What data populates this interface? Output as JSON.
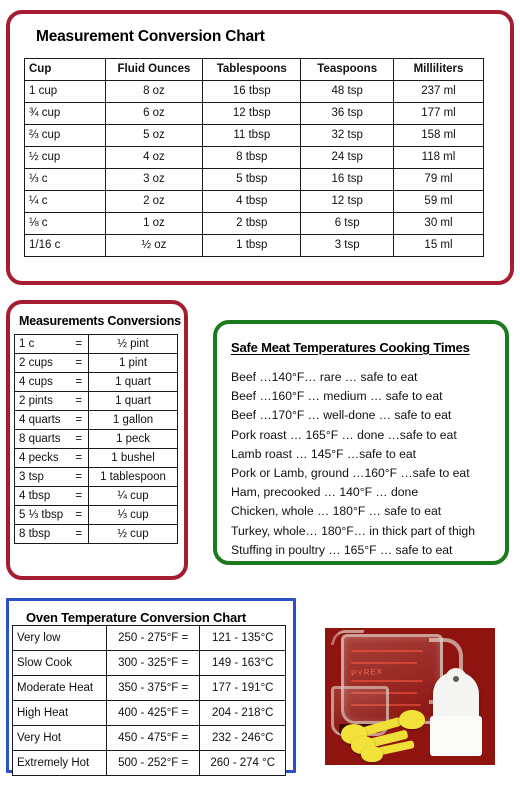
{
  "colors": {
    "red_border": "#a61c30",
    "green_border": "#1a7a1e",
    "blue_border": "#2b4fc4",
    "photo_background": "#8f1410"
  },
  "main_chart": {
    "title": "Measurement Conversion Chart",
    "headers": [
      "Cup",
      "Fluid Ounces",
      "Tablespoons",
      "Teaspoons",
      "Milliliters"
    ],
    "rows": [
      [
        "1 cup",
        "8 oz",
        "16 tbsp",
        "48 tsp",
        "237 ml"
      ],
      [
        "¾ cup",
        "6 oz",
        "12 tbsp",
        "36 tsp",
        "177 ml"
      ],
      [
        "⅔  cup",
        "5 oz",
        "11 tbsp",
        "32 tsp",
        "158 ml"
      ],
      [
        "½ cup",
        "4 oz",
        "8 tbsp",
        "24 tsp",
        "118 ml"
      ],
      [
        "⅓ c",
        "3 oz",
        "5 tbsp",
        "16 tsp",
        "79 ml"
      ],
      [
        "¼ c",
        "2 oz",
        "4 tbsp",
        "12 tsp",
        "59 ml"
      ],
      [
        "⅛ c",
        "1 oz",
        "2 tbsp",
        "6 tsp",
        "30 ml"
      ],
      [
        "1/16 c",
        "½ oz",
        "1 tbsp",
        "3 tsp",
        "15 ml"
      ]
    ]
  },
  "measurements": {
    "title": "Measurements Conversions",
    "equals_sign": "=",
    "rows": [
      {
        "quantity": "1 c",
        "result": "½ pint"
      },
      {
        "quantity": "2 cups",
        "result": "1 pint"
      },
      {
        "quantity": "4 cups",
        "result": "1 quart"
      },
      {
        "quantity": "2 pints",
        "result": "1 quart"
      },
      {
        "quantity": "4 quarts",
        "result": "1 gallon"
      },
      {
        "quantity": "8 quarts",
        "result": "1 peck"
      },
      {
        "quantity": "4 pecks",
        "result": "1 bushel"
      },
      {
        "quantity": "3 tsp",
        "result": "1 tablespoon"
      },
      {
        "quantity": "4 tbsp",
        "result": "¼ cup"
      },
      {
        "quantity": "5 ⅓ tbsp",
        "result": "⅓ cup"
      },
      {
        "quantity": "8 tbsp",
        "result": "½ cup"
      }
    ]
  },
  "meat": {
    "title": "Safe Meat Temperatures Cooking Times",
    "lines": [
      "Beef …140°F… rare … safe to eat",
      "Beef …160°F … medium … safe to eat",
      "Beef …170°F … well-done … safe to eat",
      "Pork roast … 165°F …  done …safe to eat",
      "Lamb roast … 145°F …safe to eat",
      "Pork or Lamb, ground …160°F …safe to eat",
      "Ham, precooked …  140°F … done",
      "Chicken, whole …  180°F … safe to eat",
      "Turkey, whole… 180°F… in thick part of thigh",
      "Stuffing in poultry … 165°F …  safe to eat"
    ]
  },
  "oven": {
    "title": "Oven Temperature Conversion Chart",
    "rows": [
      {
        "level": "Very low",
        "fahrenheit": "250 - 275°F =",
        "celsius": "121 - 135°C"
      },
      {
        "level": "Slow Cook",
        "fahrenheit": "300 - 325°F =",
        "celsius": "149 - 163°C"
      },
      {
        "level": "Moderate Heat",
        "fahrenheit": "350 - 375°F =",
        "celsius": "177 - 191°C"
      },
      {
        "level": "High Heat",
        "fahrenheit": "400 - 425°F =",
        "celsius": "204 - 218°C"
      },
      {
        "level": "Very Hot",
        "fahrenheit": "450 - 475°F =",
        "celsius": "232 - 246°C"
      },
      {
        "level": "Extremely Hot",
        "fahrenheit": "500 - 252°F =",
        "celsius": "260 - 274 °C"
      }
    ]
  },
  "photo": {
    "caption_text": "",
    "pyrex_label": "PYREX"
  }
}
